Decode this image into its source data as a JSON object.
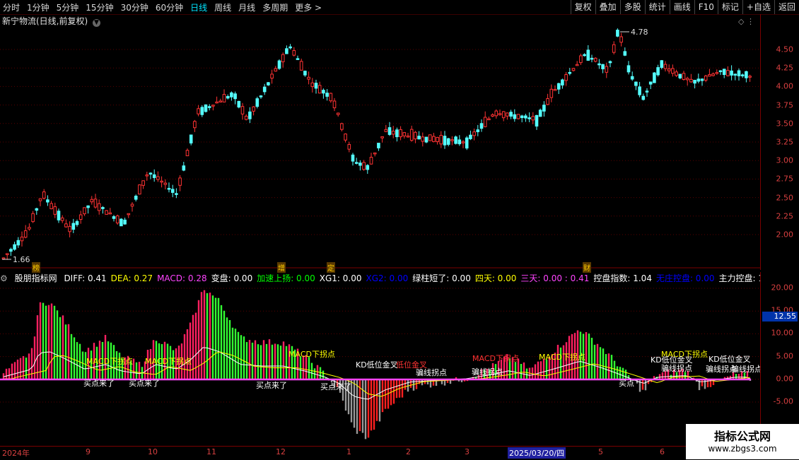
{
  "toolbar": {
    "periods": [
      "分时",
      "1分钟",
      "5分钟",
      "15分钟",
      "30分钟",
      "60分钟",
      "日线",
      "周线",
      "月线",
      "多周期",
      "更多 >"
    ],
    "active_period": "日线",
    "right_buttons": [
      "复权",
      "叠加",
      "多股",
      "统计",
      "画线",
      "F10",
      "标记",
      "+自选",
      "返回"
    ]
  },
  "main_panel": {
    "title": "新宁物流(日线,前复权)",
    "high_label": "4.78",
    "low_label": "1.66",
    "event_markers": [
      "榜",
      "增",
      "定",
      "财"
    ]
  },
  "price_scale": [
    "4.50",
    "4.25",
    "4.00",
    "3.75",
    "3.50",
    "3.25",
    "3.00",
    "2.75",
    "2.50",
    "2.25",
    "2.00"
  ],
  "indicator": {
    "name": "股朋指标网",
    "values": [
      {
        "label": "DIFF: 0.41",
        "color": "#ffffff"
      },
      {
        "label": "DEA: 0.27",
        "color": "#ffff00"
      },
      {
        "label": "MACD: 0.28",
        "color": "#ff44ff"
      },
      {
        "label": "变盘: 0.00",
        "color": "#ffffff"
      },
      {
        "label": "加速上扬: 0.00",
        "color": "#00ff00"
      },
      {
        "label": "XG1: 0.00",
        "color": "#ffffff"
      },
      {
        "label": "XG2: 0.00",
        "color": "#0000ff"
      },
      {
        "label": "绿柱短了: 0.00",
        "color": "#ffffff"
      },
      {
        "label": "四天: 0.00",
        "color": "#ffff00"
      },
      {
        "label": "三天: 0.00 : 0.41",
        "color": "#ff44ff"
      },
      {
        "label": "控盘指数: 1.04",
        "color": "#ffffff"
      },
      {
        "label": "无庄控盘: 0.00",
        "color": "#0000ff"
      },
      {
        "label": "主力控盘: 1.00",
        "color": "#ffffff"
      },
      {
        "label": "控盘减弱: 0",
        "color": "#ffff00"
      }
    ],
    "current_value": "12.55",
    "scale": [
      "20.00",
      "15.00",
      "10.00",
      "5.00",
      "0.00",
      "-5.00"
    ],
    "annotations": [
      "MACD下拐点",
      "MACD下拐点",
      "MACD下拐点",
      "MACD下拐点",
      "MACD下拐点",
      "MACD下拐点",
      "买点来了",
      "买点来了",
      "买点来了",
      "买点来了",
      "买点",
      "骗线拐点",
      "骗线拐点",
      "骗线拐点",
      "骗线拐点",
      "骗线拐点",
      "KD低位金叉",
      "KD低位金叉",
      "KD低位金叉",
      "低位金叉"
    ]
  },
  "date_axis": {
    "labels": [
      "2024年",
      "9",
      "10",
      "11",
      "12",
      "1",
      "2",
      "3",
      "2025/03/20/四",
      "5",
      "6"
    ],
    "highlight": "2025/03/20/四"
  },
  "watermark": {
    "line1": "指标公式网",
    "line2": "www.zbgs3.com"
  },
  "colors": {
    "up": "#ff3333",
    "down": "#54ffff",
    "accent": "#00e5ff",
    "grid": "#7a0000"
  }
}
